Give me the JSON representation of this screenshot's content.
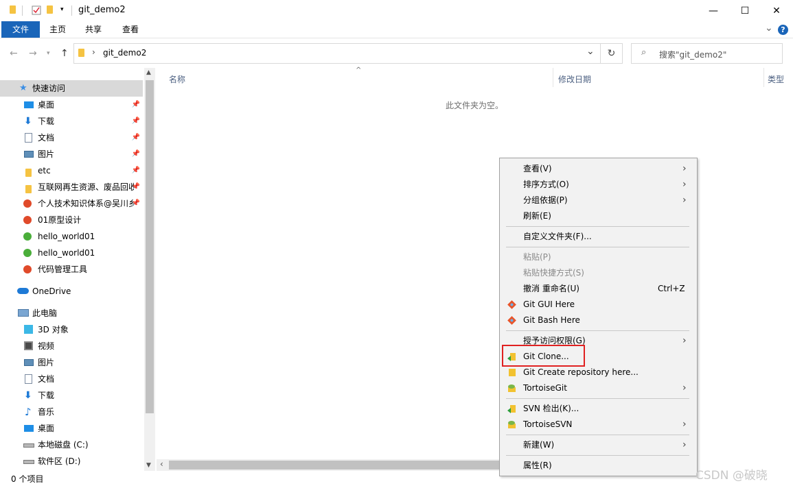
{
  "window": {
    "title": "git_demo2",
    "minimize_glyph": "—",
    "maximize_glyph": "☐",
    "close_glyph": "✕"
  },
  "ribbon": {
    "tabs": [
      {
        "label": "文件"
      },
      {
        "label": "主页"
      },
      {
        "label": "共享"
      },
      {
        "label": "查看"
      }
    ],
    "expand_glyph": "⌄",
    "help_glyph": "?"
  },
  "address": {
    "path_segment": "git_demo2",
    "dropdown_glyph": "⌄",
    "refresh_glyph": "↻",
    "search_placeholder": "搜索\"git_demo2\""
  },
  "nav": {
    "quick_access": "快速访问",
    "pinned": [
      {
        "label": "桌面",
        "icon": "desktop-icon"
      },
      {
        "label": "下载",
        "icon": "download-icon"
      },
      {
        "label": "文档",
        "icon": "documents-icon"
      },
      {
        "label": "图片",
        "icon": "pictures-icon"
      },
      {
        "label": "etc",
        "icon": "folder-icon"
      },
      {
        "label": "互联网再生资源、废品回收",
        "icon": "folder-icon"
      },
      {
        "label": "个人技术知识体系@吴川乡",
        "icon": "svn-folder-icon"
      },
      {
        "label": "01原型设计",
        "icon": "svn-folder-icon"
      },
      {
        "label": "hello_world01",
        "icon": "git-folder-icon"
      },
      {
        "label": "hello_world01",
        "icon": "git-folder-icon"
      },
      {
        "label": "代码管理工具",
        "icon": "svn-folder-icon"
      }
    ],
    "onedrive": "OneDrive",
    "this_pc": "此电脑",
    "pc_items": [
      {
        "label": "3D 对象",
        "icon": "3d-objects-icon"
      },
      {
        "label": "视频",
        "icon": "videos-icon"
      },
      {
        "label": "图片",
        "icon": "pictures-icon"
      },
      {
        "label": "文档",
        "icon": "documents-icon"
      },
      {
        "label": "下载",
        "icon": "download-icon"
      },
      {
        "label": "音乐",
        "icon": "music-icon"
      },
      {
        "label": "桌面",
        "icon": "desktop-icon"
      },
      {
        "label": "本地磁盘 (C:)",
        "icon": "drive-icon"
      },
      {
        "label": "软件区 (D:)",
        "icon": "drive-icon"
      }
    ]
  },
  "content": {
    "columns": [
      "名称",
      "修改日期",
      "类型"
    ],
    "empty_message": "此文件夹为空。"
  },
  "status": {
    "item_count": "0 个项目"
  },
  "context_menu": {
    "items": [
      {
        "label": "查看(V)",
        "submenu": true
      },
      {
        "label": "排序方式(O)",
        "submenu": true
      },
      {
        "label": "分组依据(P)",
        "submenu": true
      },
      {
        "label": "刷新(E)"
      },
      {
        "label": "自定义文件夹(F)..."
      },
      {
        "label": "粘贴(P)",
        "disabled": true
      },
      {
        "label": "粘贴快捷方式(S)",
        "disabled": true
      },
      {
        "label": "撤消 重命名(U)",
        "shortcut": "Ctrl+Z"
      },
      {
        "label": "Git GUI Here",
        "icon": "git-gui-icon"
      },
      {
        "label": "Git Bash Here",
        "icon": "git-bash-icon"
      },
      {
        "label": "授予访问权限(G)",
        "submenu": true
      },
      {
        "label": "Git Clone...",
        "icon": "git-clone-icon",
        "highlighted": true
      },
      {
        "label": "Git Create repository here...",
        "icon": "git-create-repo-icon"
      },
      {
        "label": "TortoiseGit",
        "icon": "tortoisegit-icon",
        "submenu": true
      },
      {
        "label": "SVN 检出(K)...",
        "icon": "svn-checkout-icon"
      },
      {
        "label": "TortoiseSVN",
        "icon": "tortoisesvn-icon",
        "submenu": true
      },
      {
        "label": "新建(W)",
        "submenu": true
      },
      {
        "label": "属性(R)"
      }
    ],
    "submenu_glyph": "›"
  },
  "watermark": "CSDN @破晓",
  "colors": {
    "ribbon_file_tab": "#1a65b9",
    "highlight_box": "#e02020",
    "menu_bg": "#f2f2f2"
  }
}
